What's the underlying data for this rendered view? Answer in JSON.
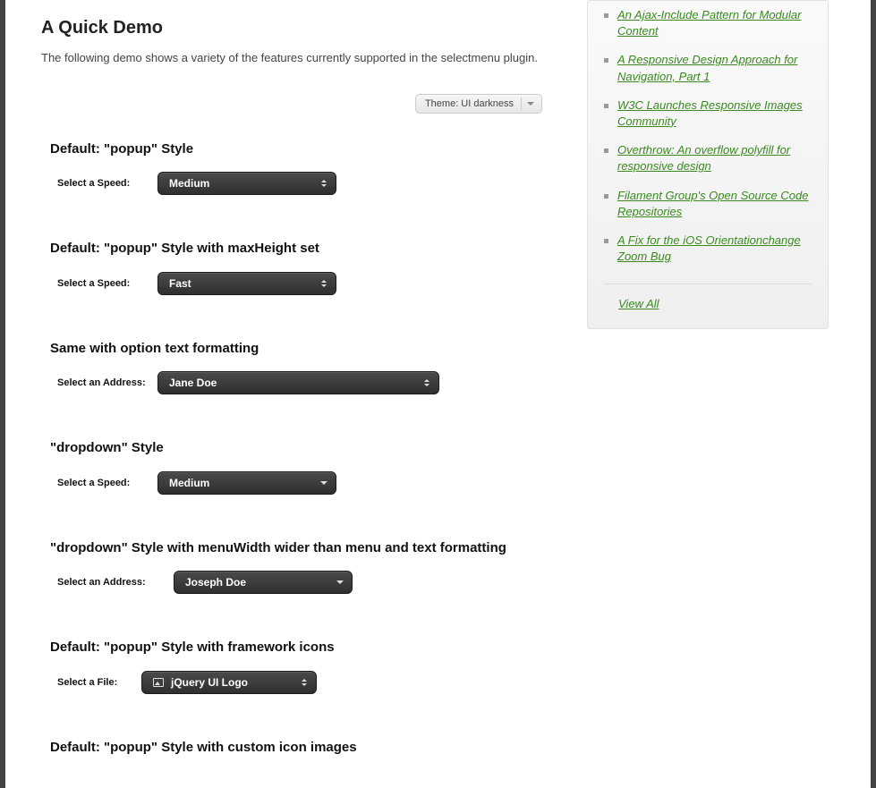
{
  "main": {
    "title": "A Quick Demo",
    "intro": "The following demo shows a variety of the features currently supported in the selectmenu plugin.",
    "theme_selector": "Theme: UI darkness"
  },
  "sections": {
    "s1": {
      "title": "Default: \"popup\" Style",
      "label": "Select a Speed:",
      "value": "Medium"
    },
    "s2": {
      "title": "Default: \"popup\" Style with maxHeight set",
      "label": "Select a Speed:",
      "value": "Fast"
    },
    "s3": {
      "title": "Same with option text formatting",
      "label": "Select an Address:",
      "value": "Jane Doe"
    },
    "s4": {
      "title": "\"dropdown\" Style",
      "label": "Select a Speed:",
      "value": "Medium"
    },
    "s5": {
      "title": "\"dropdown\" Style with menuWidth wider than menu and text formatting",
      "label": "Select an Address:",
      "value": "Joseph Doe"
    },
    "s6": {
      "title": "Default: \"popup\" Style with framework icons",
      "label": "Select a File:",
      "value": "jQuery UI Logo"
    },
    "s7": {
      "title": "Default: \"popup\" Style with custom icon images"
    }
  },
  "sidebar": {
    "links": [
      "An Ajax-Include Pattern for Modular Content",
      "A Responsive Design Approach for Navigation, Part 1",
      "W3C Launches Responsive Images Community",
      "Overthrow: An overflow polyfill for responsive design",
      "Filament Group's Open Source Code Repositories",
      "A Fix for the iOS Orientationchange Zoom Bug"
    ],
    "view_all": "View All"
  }
}
